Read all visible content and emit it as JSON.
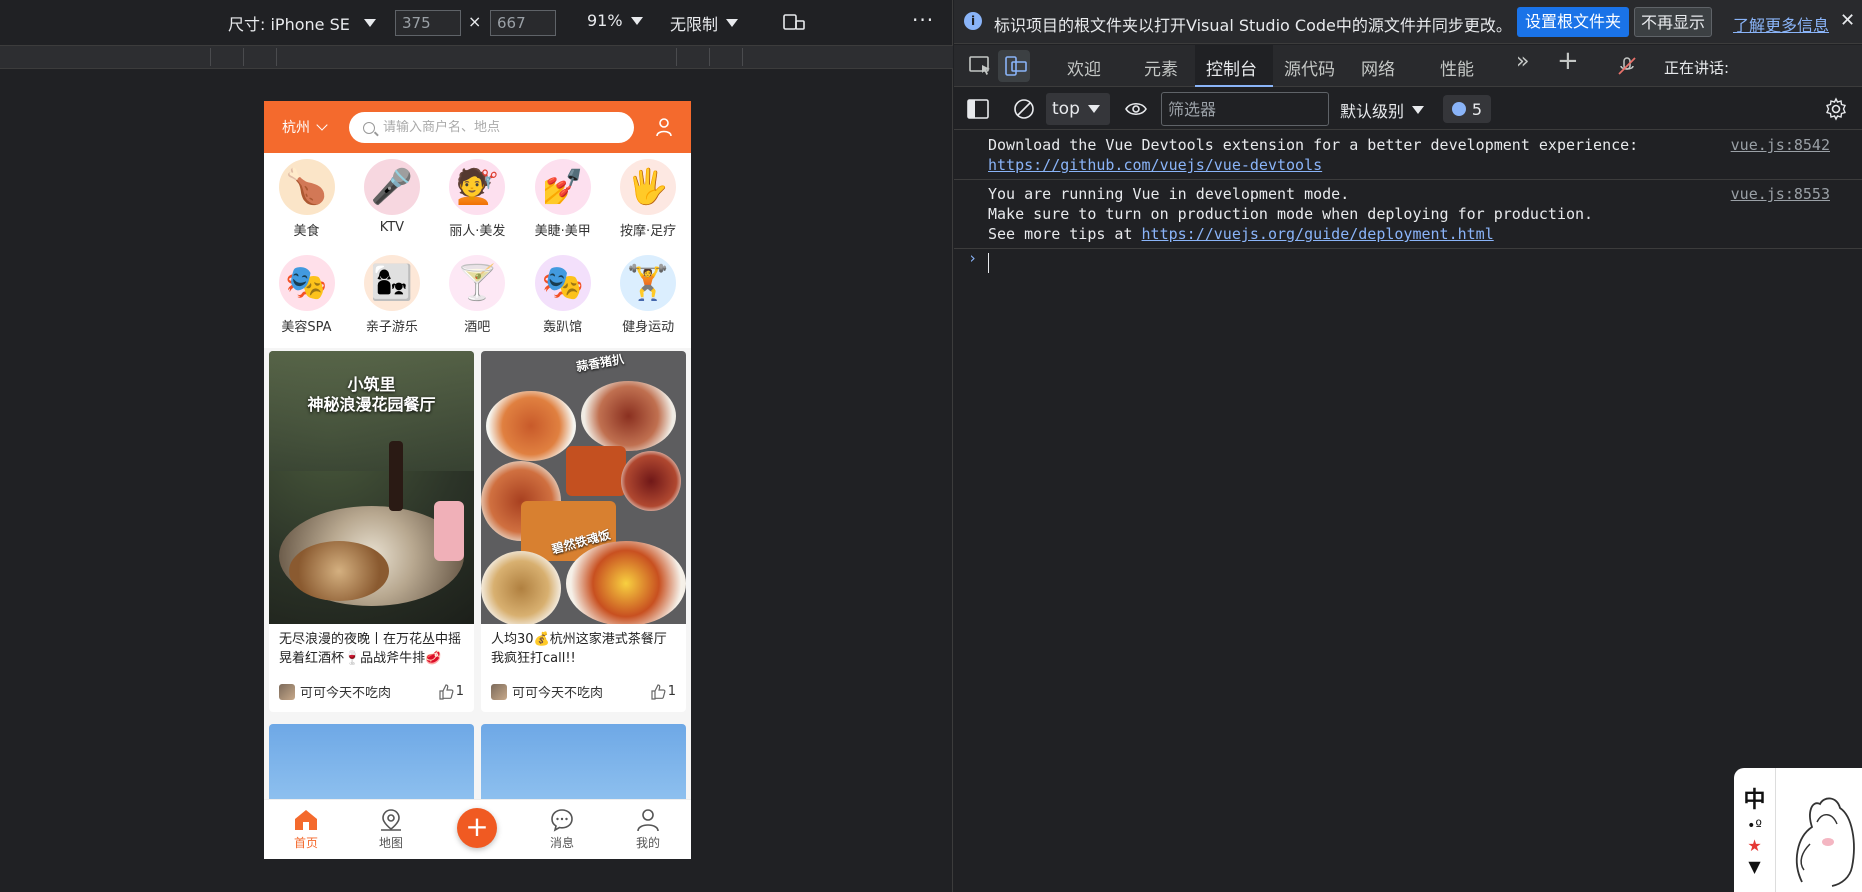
{
  "emulator": {
    "device_label": "尺寸: iPhone SE",
    "width": "375",
    "height": "667",
    "times": "×",
    "zoom": "91%",
    "throttle": "无限制",
    "more": "⋮"
  },
  "phone": {
    "city": "杭州",
    "search_placeholder": "请输入商户名、地点",
    "categories": [
      {
        "label": "美食",
        "icon": "roast-chicken-icon",
        "glyph": "🍗",
        "color": "#fbe5c8"
      },
      {
        "label": "KTV",
        "icon": "microphone-icon",
        "glyph": "🎤",
        "color": "#f7d7e0"
      },
      {
        "label": "丽人·美发",
        "icon": "hair-salon-icon",
        "glyph": "💇",
        "color": "#fde0ef"
      },
      {
        "label": "美睫·美甲",
        "icon": "nail-salon-icon",
        "glyph": "💅",
        "color": "#fde0ef"
      },
      {
        "label": "按摩·足疗",
        "icon": "massage-icon",
        "glyph": "🖐",
        "color": "#fde8e2"
      },
      {
        "label": "美容SPA",
        "icon": "face-mask-icon",
        "glyph": "🎭",
        "color": "#ffe0ea"
      },
      {
        "label": "亲子游乐",
        "icon": "family-icon",
        "glyph": "👩‍👧",
        "color": "#fde8d8"
      },
      {
        "label": "酒吧",
        "icon": "cocktail-icon",
        "glyph": "🍸",
        "color": "#fde8f5"
      },
      {
        "label": "轰趴馆",
        "icon": "party-mask-icon",
        "glyph": "🎭",
        "color": "#f3e0fb"
      },
      {
        "label": "健身运动",
        "icon": "dumbbell-icon",
        "glyph": "🏋",
        "color": "#dbeefe"
      }
    ],
    "cards": [
      {
        "overlay_line1": "小筑里",
        "overlay_line2": "神秘浪漫花园餐厅",
        "title": "无尽浪漫的夜晚丨在万花丛中摇晃着红酒杯🍷品战斧牛排🥩",
        "author": "可可今天不吃肉",
        "likes": "1"
      },
      {
        "overlay_line1": "蒜香猪扒",
        "overlay_line2": "碧然铁魂饭",
        "title": "人均30💰杭州这家港式茶餐厅我疯狂打call!!",
        "author": "可可今天不吃肉",
        "likes": "1"
      }
    ],
    "tabbar": [
      {
        "label": "首页",
        "icon": "home-icon",
        "active": true
      },
      {
        "label": "地图",
        "icon": "map-pin-icon",
        "active": false
      },
      {
        "label": "",
        "icon": "plus-icon",
        "active": false
      },
      {
        "label": "消息",
        "icon": "chat-icon",
        "active": false
      },
      {
        "label": "我的",
        "icon": "person-icon",
        "active": false
      }
    ],
    "fab": "+"
  },
  "devtools": {
    "info": {
      "message": "标识项目的根文件夹以打开Visual Studio Code中的源文件并同步更改。",
      "set_root": "设置根文件夹",
      "dont_show": "不再显示",
      "learn_more": "了解更多信息",
      "close": "✕"
    },
    "tabs": [
      "欢迎",
      "元素",
      "控制台",
      "源代码",
      "网络",
      "性能"
    ],
    "more_tabs": "»",
    "add_tab": "+",
    "speaking": "正在讲话:",
    "console_toolbar": {
      "context": "top",
      "filter_placeholder": "筛选器",
      "level": "默认级别",
      "issues_count": "5"
    },
    "messages": [
      {
        "lines": [
          "Download the Vue Devtools extension for a better development experience:"
        ],
        "link": "https://github.com/vuejs/vue-devtools",
        "source": "vue.js:8542"
      },
      {
        "lines": [
          "You are running Vue in development mode.",
          "Make sure to turn on production mode when deploying for production."
        ],
        "prefix": "See more tips at ",
        "link": "https://vuejs.org/guide/deployment.html",
        "source": "vue.js:8553"
      }
    ],
    "prompt": "›"
  },
  "widget": {
    "char": "中",
    "symbols": "•º"
  }
}
